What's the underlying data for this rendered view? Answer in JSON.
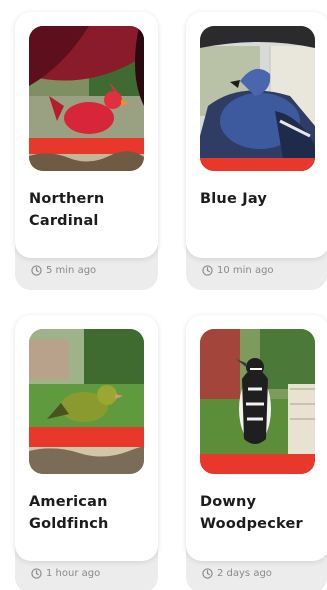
{
  "birds": [
    {
      "name_line1": "Northern",
      "name_line2": "Cardinal",
      "time": "5 min ago"
    },
    {
      "name_line1": "Blue Jay",
      "name_line2": "",
      "time": "10 min ago"
    },
    {
      "name_line1": "American",
      "name_line2": "Goldfinch",
      "time": "1 hour ago"
    },
    {
      "name_line1": "Downy",
      "name_line2": "Woodpecker",
      "time": "2 days ago"
    }
  ],
  "icons": {
    "time": "clock-icon"
  },
  "colors": {
    "card_bg": "#ffffff",
    "card_shadow": "#ececec",
    "title_text": "#1c1c1c",
    "meta_text": "#8a8a8a",
    "feeder_red": "#e8382c"
  }
}
